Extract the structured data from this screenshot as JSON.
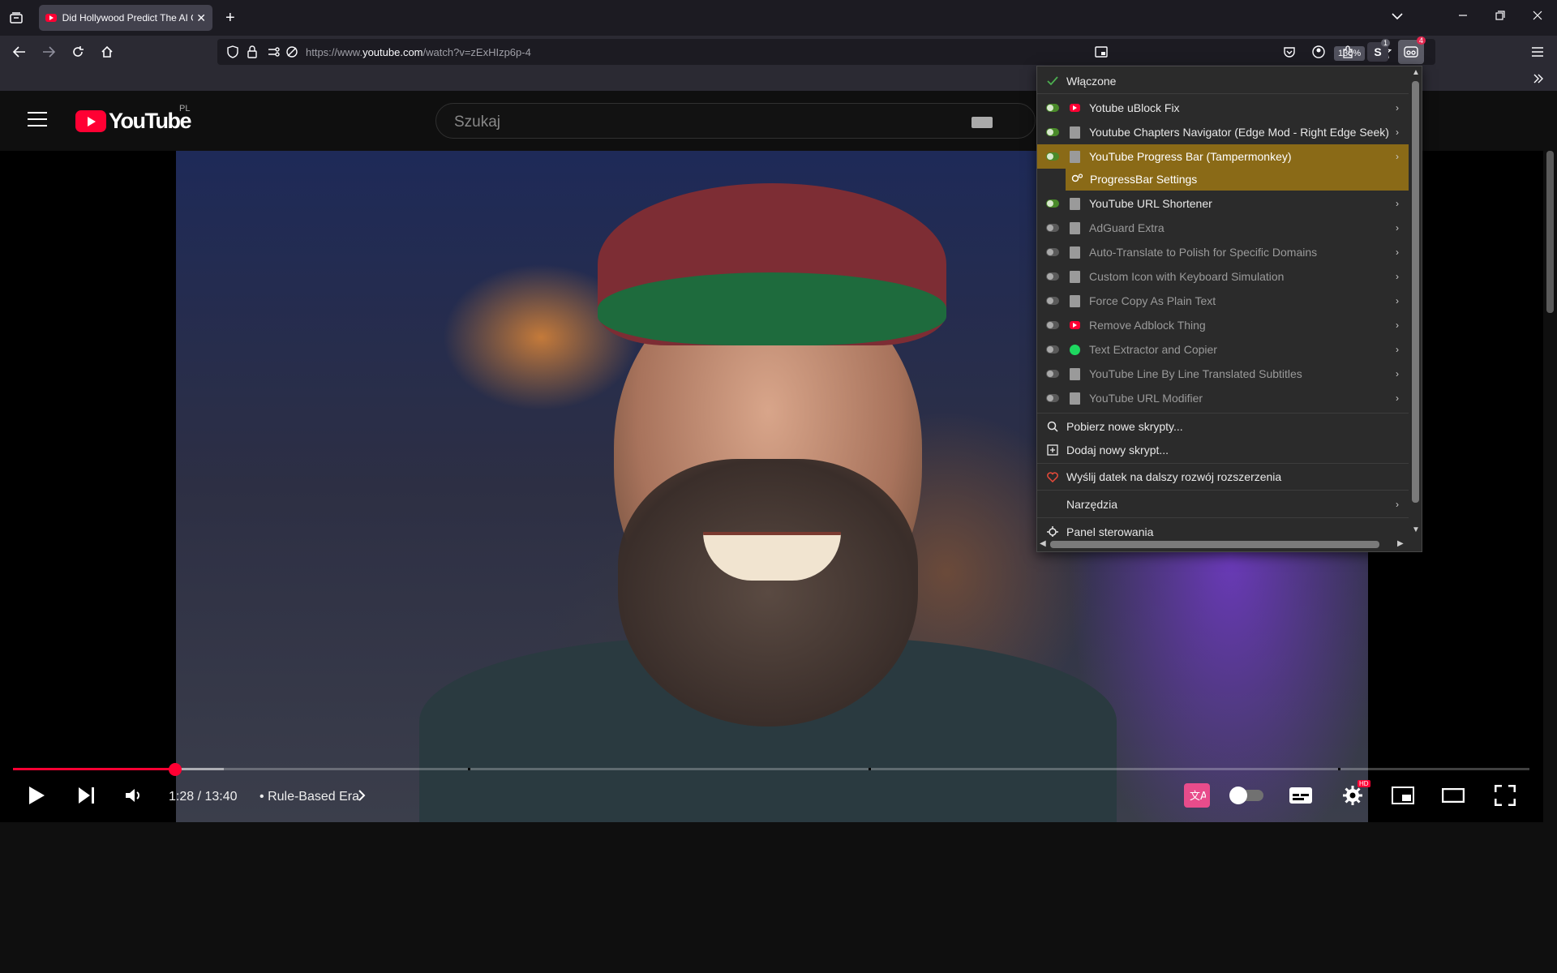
{
  "browser": {
    "tab": {
      "title": "Did Hollywood Predict The AI C",
      "close": "✕"
    },
    "new_tab": "+",
    "url": {
      "prefix": "https://www.",
      "domain": "youtube.com",
      "path": "/watch?v=zExHIzp6p-4"
    },
    "zoom": "130%",
    "extensions_badge": "1",
    "tampermonkey_badge": "4"
  },
  "youtube": {
    "logo_text": "YouTube",
    "region": "PL",
    "search_placeholder": "Szukaj",
    "player": {
      "time": "1:28 / 13:40",
      "chapter_separator": "•",
      "chapter": "Rule-Based Era",
      "progress": 0.107,
      "buffered": 0.139,
      "chapter_marks": [
        0.3,
        0.564,
        0.874
      ],
      "hd_badge": "HD"
    }
  },
  "tampermonkey_menu": {
    "enabled_label": "Włączone",
    "scripts": [
      {
        "name": "Yotube uBlock Fix",
        "enabled": true,
        "icon": "youtube-icon"
      },
      {
        "name": "Youtube Chapters Navigator (Edge Mod - Right Edge Seek)",
        "enabled": true,
        "icon": "script-icon"
      },
      {
        "name": "YouTube Progress Bar (Tampermonkey)",
        "enabled": true,
        "icon": "script-icon",
        "highlighted": true,
        "submenu": "ProgressBar Settings"
      },
      {
        "name": "YouTube URL Shortener",
        "enabled": true,
        "icon": "script-icon"
      },
      {
        "name": "AdGuard Extra",
        "enabled": false,
        "icon": "script-icon"
      },
      {
        "name": "Auto-Translate to Polish for Specific Domains",
        "enabled": false,
        "icon": "script-icon"
      },
      {
        "name": "Custom Icon with Keyboard Simulation",
        "enabled": false,
        "icon": "script-icon"
      },
      {
        "name": "Force Copy As Plain Text",
        "enabled": false,
        "icon": "script-icon"
      },
      {
        "name": "Remove Adblock Thing",
        "enabled": false,
        "icon": "youtube-icon"
      },
      {
        "name": "Text Extractor and Copier",
        "enabled": false,
        "icon": "spotify-icon"
      },
      {
        "name": "YouTube Line By Line Translated Subtitles",
        "enabled": false,
        "icon": "script-icon"
      },
      {
        "name": "YouTube URL Modifier",
        "enabled": false,
        "icon": "script-icon"
      }
    ],
    "get_new_scripts": "Pobierz nowe skrypty...",
    "add_new_script": "Dodaj nowy skrypt...",
    "donate": "Wyślij datek na dalszy rozwój rozszerzenia",
    "tools": "Narzędzia",
    "dashboard": "Panel sterowania"
  },
  "colors": {
    "menu_highlight": "#8a6a17",
    "youtube_red": "#ff0033",
    "toggle_on": "#4a8a2a"
  }
}
